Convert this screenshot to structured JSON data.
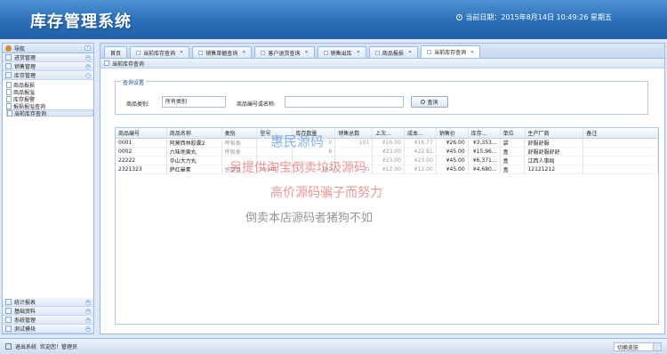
{
  "header": {
    "logo": "库存管理系统",
    "date": "当前日期：2015年8月14日 10:49:26 星期五"
  },
  "nav": {
    "title": "导航",
    "sections": [
      {
        "label": "进货管理"
      },
      {
        "label": "销售管理"
      },
      {
        "label": "库存管理"
      }
    ],
    "tree": [
      "商品报损",
      "商品报溢",
      "库存报警",
      "报损报溢查询",
      "当前库存查询"
    ],
    "bottom_sections": [
      "统计报表",
      "基础资料",
      "系统管理",
      "测试模块"
    ]
  },
  "tabs": [
    {
      "label": "首页"
    },
    {
      "label": "当前库存查询"
    },
    {
      "label": "销售单据查询"
    },
    {
      "label": "客户退货查询"
    },
    {
      "label": "销售出库"
    },
    {
      "label": "商品报损"
    },
    {
      "label": "当前库存查询"
    }
  ],
  "page_title": "当前库存查询",
  "query": {
    "legend": "查询设置",
    "category_label": "商品类别:",
    "category_value": "所有类别",
    "code_label": "商品编号或名称:",
    "code_value": "",
    "search_button": "查询"
  },
  "table": {
    "columns": [
      "商品编号",
      "商品名称",
      "类别",
      "型号",
      "库存数量",
      "销售总数",
      "上次...",
      "成本...",
      "销售价",
      "库存...",
      "单位",
      "生产厂商",
      "备注"
    ],
    "rows": [
      [
        "0001",
        "阿莫西林胶囊2",
        "呼吸类",
        "",
        "0",
        "101",
        "¥16.00",
        "¥16.77",
        "¥26.00",
        "¥3,353...",
        "袋",
        "舒服舒服",
        ""
      ],
      [
        "0002",
        "六味地黄丸",
        "呼吸类",
        "",
        "6",
        "",
        "¥23.00",
        "¥22.81",
        "¥45.00",
        "¥15,96...",
        "盒",
        "舒服舒服舒舒",
        ""
      ],
      [
        "22222",
        "华山大力丸",
        "",
        "",
        "",
        "",
        "¥23.00",
        "¥23.00",
        "¥45.00",
        "¥6,371...",
        "盒",
        "江西人事局",
        ""
      ],
      [
        "2321323",
        "萨红晕素",
        "感冒类",
        "asdad",
        "390",
        "0",
        "¥12.00",
        "¥12.00",
        "¥45.00",
        "¥4,680...",
        "盒",
        "12121212",
        ""
      ]
    ]
  },
  "watermark": [
    "惠民源码",
    "另提供淘宝倒卖垃圾源码",
    "高价源码骗子而努力",
    "倒卖本店源码者猪狗不如"
  ],
  "footer": {
    "exit": "退出系统",
    "welcome": "欢迎您！管理员",
    "skin": "切换皮肤"
  },
  "colors": {
    "header": "#2a6fb9",
    "border": "#99bbe8"
  }
}
